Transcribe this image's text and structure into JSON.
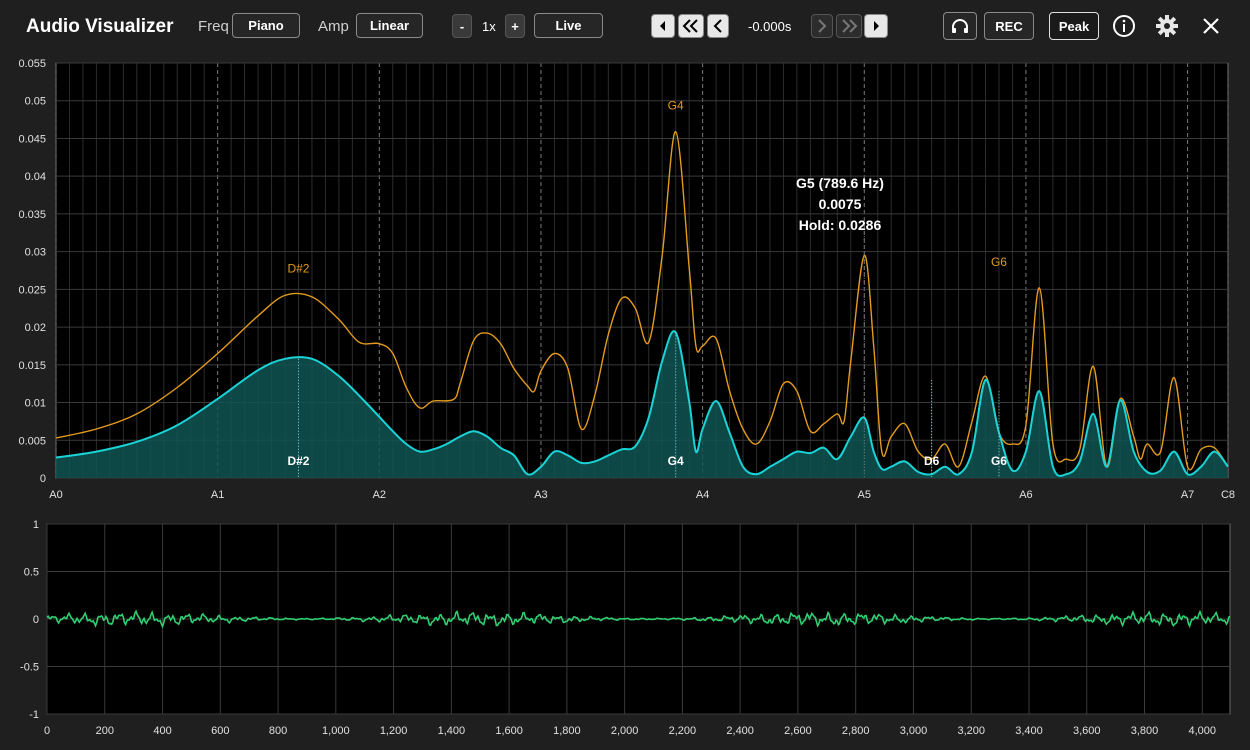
{
  "app": {
    "title": "Audio Visualizer"
  },
  "toolbar": {
    "freq_label": "Freq",
    "freq_value": "Piano",
    "amp_label": "Amp",
    "amp_value": "Linear",
    "zoom_minus": "-",
    "zoom_value": "1x",
    "zoom_plus": "+",
    "live_label": "Live",
    "time_value": "-0.000s",
    "rec_label": "REC",
    "peak_label": "Peak",
    "icons": [
      "step-back-icon",
      "rewind-icon",
      "prev-icon",
      "next-icon",
      "fast-forward-icon",
      "step-forward-icon",
      "headphones-icon",
      "info-icon",
      "gear-icon",
      "close-icon"
    ]
  },
  "colors": {
    "spectrum": "#19d3d6",
    "hold": "#e39b1e",
    "waveform": "#2fcf72",
    "grid": "#3a3a3a"
  },
  "chart_data": [
    {
      "type": "area",
      "note_axis": {
        "labels": [
          "A0",
          "A1",
          "A2",
          "A3",
          "A4",
          "A5",
          "A6",
          "A7",
          "C8"
        ],
        "midi": [
          21,
          33,
          45,
          57,
          69,
          81,
          93,
          105,
          108
        ]
      },
      "y_ticks": [
        "0",
        "0.005",
        "0.01",
        "0.015",
        "0.02",
        "0.025",
        "0.03",
        "0.035",
        "0.04",
        "0.045",
        "0.05",
        "0.055"
      ],
      "ylim": [
        0,
        0.055
      ],
      "series": [
        {
          "key": "hold",
          "color": "#e39b1e",
          "points": [
            [
              21,
              0.0053
            ],
            [
              24,
              0.0065
            ],
            [
              27,
              0.0085
            ],
            [
              30,
              0.012
            ],
            [
              33,
              0.0165
            ],
            [
              36,
              0.0215
            ],
            [
              38,
              0.0242
            ],
            [
              40,
              0.024
            ],
            [
              42,
              0.021
            ],
            [
              43.5,
              0.018
            ],
            [
              45,
              0.0178
            ],
            [
              46,
              0.0165
            ],
            [
              47,
              0.012
            ],
            [
              48,
              0.0093
            ],
            [
              49,
              0.0102
            ],
            [
              50.5,
              0.0104
            ],
            [
              51,
              0.0125
            ],
            [
              52,
              0.0182
            ],
            [
              53,
              0.0192
            ],
            [
              54,
              0.0178
            ],
            [
              55,
              0.0145
            ],
            [
              56,
              0.0122
            ],
            [
              56.5,
              0.0115
            ],
            [
              57,
              0.0142
            ],
            [
              58,
              0.0165
            ],
            [
              59,
              0.0145
            ],
            [
              60,
              0.0065
            ],
            [
              61,
              0.011
            ],
            [
              62,
              0.019
            ],
            [
              63,
              0.0238
            ],
            [
              64,
              0.0225
            ],
            [
              65,
              0.018
            ],
            [
              66,
              0.0295
            ],
            [
              67,
              0.0459
            ],
            [
              68,
              0.028
            ],
            [
              68.5,
              0.0175
            ],
            [
              69,
              0.0175
            ],
            [
              70,
              0.0185
            ],
            [
              71,
              0.0115
            ],
            [
              72,
              0.0065
            ],
            [
              73,
              0.0045
            ],
            [
              74,
              0.0075
            ],
            [
              75,
              0.0125
            ],
            [
              76,
              0.0115
            ],
            [
              77,
              0.0062
            ],
            [
              78,
              0.0072
            ],
            [
              79,
              0.0085
            ],
            [
              79.5,
              0.0075
            ],
            [
              80,
              0.0155
            ],
            [
              81,
              0.0295
            ],
            [
              81.7,
              0.0175
            ],
            [
              82.3,
              0.0035
            ],
            [
              83,
              0.0055
            ],
            [
              84,
              0.0072
            ],
            [
              85,
              0.0035
            ],
            [
              86,
              0.0025
            ],
            [
              87,
              0.0045
            ],
            [
              88,
              0.0015
            ],
            [
              89,
              0.0075
            ],
            [
              90,
              0.0135
            ],
            [
              91,
              0.006
            ],
            [
              92,
              0.0045
            ],
            [
              93,
              0.007
            ],
            [
              94,
              0.0252
            ],
            [
              95,
              0.0045
            ],
            [
              96,
              0.0025
            ],
            [
              97,
              0.0038
            ],
            [
              98,
              0.0148
            ],
            [
              99,
              0.0015
            ],
            [
              100,
              0.0105
            ],
            [
              101,
              0.0055
            ],
            [
              101.5,
              0.0025
            ],
            [
              102,
              0.0045
            ],
            [
              103,
              0.0035
            ],
            [
              104,
              0.0133
            ],
            [
              105,
              0.0015
            ],
            [
              106,
              0.0038
            ],
            [
              107,
              0.004
            ],
            [
              108,
              0.0015
            ]
          ]
        },
        {
          "key": "spectrum",
          "color": "#19d3d6",
          "points": [
            [
              21,
              0.0027
            ],
            [
              24,
              0.0035
            ],
            [
              27,
              0.0048
            ],
            [
              30,
              0.007
            ],
            [
              33,
              0.0105
            ],
            [
              36,
              0.0143
            ],
            [
              38,
              0.0158
            ],
            [
              40,
              0.0158
            ],
            [
              42,
              0.0135
            ],
            [
              44,
              0.01
            ],
            [
              46,
              0.0062
            ],
            [
              47,
              0.0045
            ],
            [
              48,
              0.0035
            ],
            [
              49,
              0.0038
            ],
            [
              50,
              0.0045
            ],
            [
              51,
              0.0055
            ],
            [
              52,
              0.0062
            ],
            [
              53,
              0.0055
            ],
            [
              54,
              0.004
            ],
            [
              55,
              0.003
            ],
            [
              56,
              0.0005
            ],
            [
              57,
              0.0015
            ],
            [
              58,
              0.0035
            ],
            [
              59,
              0.003
            ],
            [
              60,
              0.002
            ],
            [
              61,
              0.0022
            ],
            [
              62,
              0.003
            ],
            [
              63,
              0.0038
            ],
            [
              64,
              0.0042
            ],
            [
              65,
              0.008
            ],
            [
              66,
              0.0155
            ],
            [
              67,
              0.0193
            ],
            [
              68,
              0.0102
            ],
            [
              68.5,
              0.0035
            ],
            [
              69,
              0.0065
            ],
            [
              70,
              0.0102
            ],
            [
              71,
              0.006
            ],
            [
              72,
              0.0015
            ],
            [
              73,
              0.0005
            ],
            [
              74,
              0.0015
            ],
            [
              75,
              0.0025
            ],
            [
              76,
              0.0035
            ],
            [
              77,
              0.0033
            ],
            [
              78,
              0.004
            ],
            [
              79,
              0.0025
            ],
            [
              80,
              0.0055
            ],
            [
              81,
              0.008
            ],
            [
              81.7,
              0.0035
            ],
            [
              82.3,
              0.0012
            ],
            [
              83,
              0.0015
            ],
            [
              84,
              0.0022
            ],
            [
              85,
              0.0008
            ],
            [
              86,
              0.0005
            ],
            [
              87,
              0.0015
            ],
            [
              88,
              0.0005
            ],
            [
              89,
              0.0035
            ],
            [
              90,
              0.013
            ],
            [
              91,
              0.006
            ],
            [
              92,
              0.001
            ],
            [
              93,
              0.0035
            ],
            [
              94,
              0.0115
            ],
            [
              95,
              0.0015
            ],
            [
              96,
              0.0005
            ],
            [
              97,
              0.0022
            ],
            [
              98,
              0.0085
            ],
            [
              99,
              0.0015
            ],
            [
              100,
              0.0103
            ],
            [
              101,
              0.0035
            ],
            [
              102,
              0.0008
            ],
            [
              103,
              0.001
            ],
            [
              104,
              0.0035
            ],
            [
              105,
              0.0005
            ],
            [
              106,
              0.0015
            ],
            [
              107,
              0.0035
            ],
            [
              108,
              0.0015
            ]
          ]
        }
      ],
      "peak_labels": [
        {
          "note": "D#2",
          "midi": 39,
          "hold_value": 0.0243,
          "value": 0.0158
        },
        {
          "note": "G4",
          "midi": 67,
          "hold_value": 0.0459,
          "value": 0.0193
        },
        {
          "note": "G6",
          "midi": 91,
          "hold_value": 0.0252,
          "value": 0.0115
        },
        {
          "note": "D6",
          "midi": 86,
          "value": 0.013
        }
      ],
      "tooltip": {
        "line1": "G5 (789.6 Hz)",
        "line2": "0.0075",
        "line3": "Hold: 0.0286",
        "midi": 81
      }
    },
    {
      "type": "line",
      "x_ticks": [
        "0",
        "200",
        "400",
        "600",
        "800",
        "1,000",
        "1,200",
        "1,400",
        "1,600",
        "1,800",
        "2,000",
        "2,200",
        "2,400",
        "2,600",
        "2,800",
        "3,000",
        "3,200",
        "3,400",
        "3,600",
        "3,800",
        "4,000"
      ],
      "xlim": [
        0,
        4096
      ],
      "y_ticks": [
        "-1",
        "-0.5",
        "0",
        "0.5",
        "1"
      ],
      "ylim": [
        -1,
        1
      ],
      "series": [
        {
          "key": "waveform",
          "color": "#2fcf72",
          "amplitude": 0.07
        }
      ]
    }
  ]
}
